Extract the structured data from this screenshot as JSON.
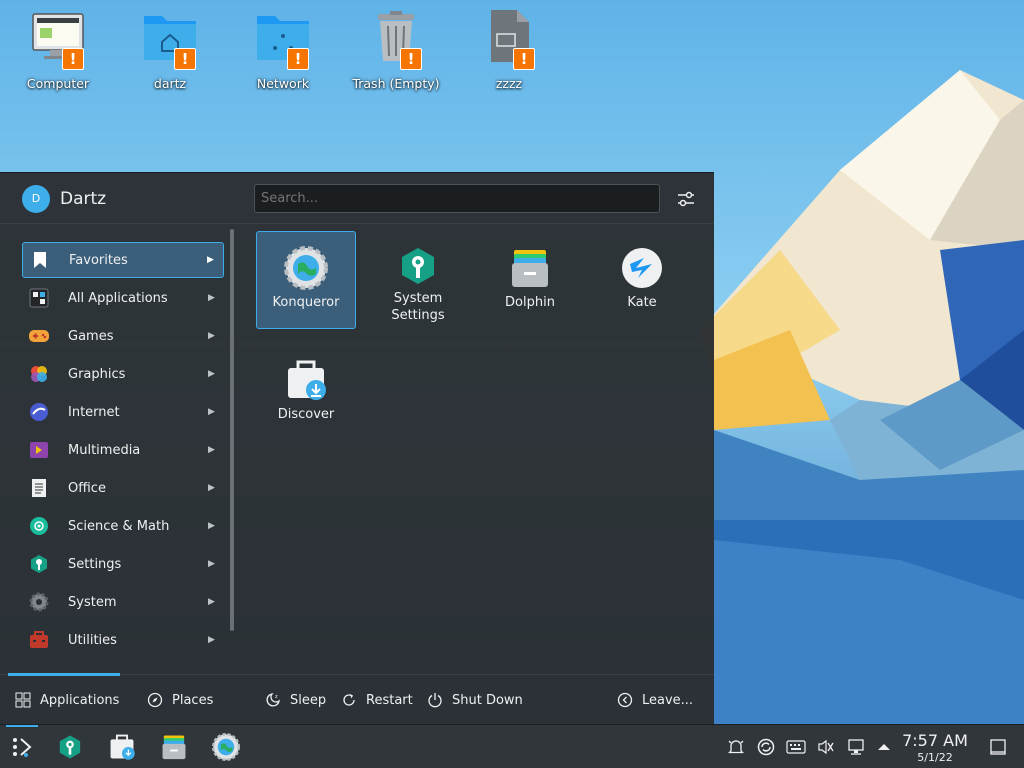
{
  "desktop": {
    "icons": [
      {
        "label": "Computer",
        "icon": "computer-icon"
      },
      {
        "label": "dartz",
        "icon": "home-folder-icon"
      },
      {
        "label": "Network",
        "icon": "network-folder-icon"
      },
      {
        "label": "Trash (Empty)",
        "icon": "trash-icon"
      },
      {
        "label": "zzzz",
        "icon": "file-icon"
      }
    ],
    "badge_text": "!"
  },
  "launcher": {
    "user": {
      "name": "Dartz",
      "avatar_letter": "D"
    },
    "search": {
      "placeholder": "Search..."
    },
    "categories": [
      {
        "label": "Favorites",
        "icon": "bookmark-icon",
        "active": true
      },
      {
        "label": "All Applications",
        "icon": "all-apps-icon"
      },
      {
        "label": "Games",
        "icon": "gamepad-icon"
      },
      {
        "label": "Graphics",
        "icon": "graphics-icon"
      },
      {
        "label": "Internet",
        "icon": "internet-icon"
      },
      {
        "label": "Multimedia",
        "icon": "multimedia-icon"
      },
      {
        "label": "Office",
        "icon": "office-icon"
      },
      {
        "label": "Science & Math",
        "icon": "science-icon"
      },
      {
        "label": "Settings",
        "icon": "settings-wrench-icon"
      },
      {
        "label": "System",
        "icon": "system-gear-icon"
      },
      {
        "label": "Utilities",
        "icon": "utilities-icon"
      }
    ],
    "favorites": [
      {
        "label": "Konqueror",
        "icon": "konqueror-icon",
        "selected": true
      },
      {
        "label": "System Settings",
        "icon": "system-settings-icon"
      },
      {
        "label": "Dolphin",
        "icon": "dolphin-icon"
      },
      {
        "label": "Kate",
        "icon": "kate-icon"
      },
      {
        "label": "Discover",
        "icon": "discover-icon"
      }
    ],
    "footer": {
      "applications": "Applications",
      "places": "Places",
      "sleep": "Sleep",
      "restart": "Restart",
      "shutdown": "Shut Down",
      "leave": "Leave..."
    }
  },
  "taskbar": {
    "pinned": [
      "launcher-icon",
      "system-settings-icon",
      "discover-icon",
      "dolphin-icon",
      "konqueror-icon"
    ],
    "tray": [
      "notifications-icon",
      "updates-icon",
      "keyboard-icon",
      "volume-muted-icon",
      "network-icon",
      "expand-tray-icon"
    ],
    "clock": {
      "time": "7:57 AM",
      "date": "5/1/22"
    }
  },
  "colors": {
    "accent": "#3daee9",
    "warning": "#f67400",
    "panel": "#2a2e32"
  }
}
